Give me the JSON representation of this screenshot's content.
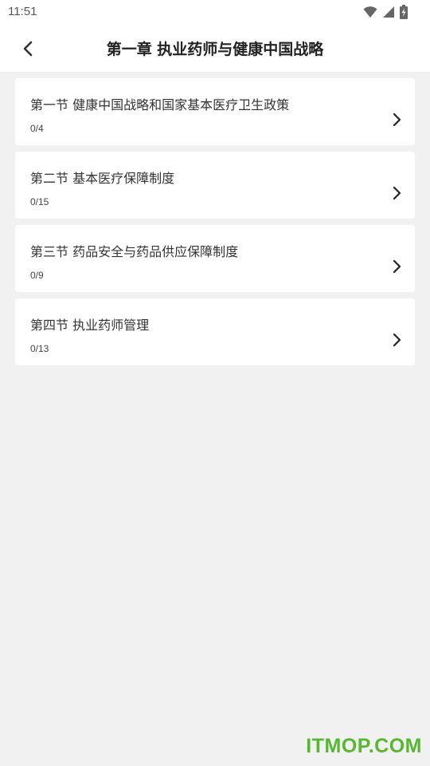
{
  "status_bar": {
    "time": "11:51",
    "icons": [
      "wifi-icon",
      "cell-signal-icon",
      "battery-charging-icon"
    ]
  },
  "header": {
    "back_icon": "chevron-left-icon",
    "title": "第一章 执业药师与健康中国战略"
  },
  "sections": [
    {
      "title": "第一节 健康中国战略和国家基本医疗卫生政策",
      "progress": "0/4"
    },
    {
      "title": "第二节 基本医疗保障制度",
      "progress": "0/15"
    },
    {
      "title": "第三节 药品安全与药品供应保障制度",
      "progress": "0/9"
    },
    {
      "title": "第四节 执业药师管理",
      "progress": "0/13"
    }
  ],
  "watermark": "ITMOP.COM",
  "colors": {
    "background": "#f1f1f1",
    "card": "#ffffff",
    "watermark": "#55b82e"
  }
}
